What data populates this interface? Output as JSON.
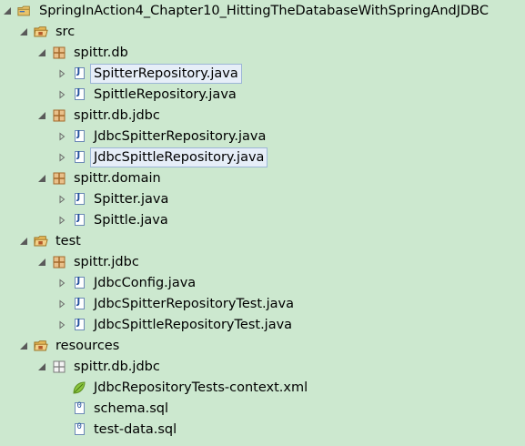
{
  "tree": {
    "project": "SpringInAction4_Chapter10_HittingTheDatabaseWithSpringAndJDBC",
    "src": "src",
    "pkg_db": "spittr.db",
    "spitter_repository": "SpitterRepository.java",
    "spittle_repository": "SpittleRepository.java",
    "pkg_db_jdbc": "spittr.db.jdbc",
    "jdbc_spitter_repository": "JdbcSpitterRepository.java",
    "jdbc_spittle_repository": "JdbcSpittleRepository.java",
    "pkg_domain": "spittr.domain",
    "spitter_java": "Spitter.java",
    "spittle_java": "Spittle.java",
    "test": "test",
    "pkg_jdbc": "spittr.jdbc",
    "jdbc_config": "JdbcConfig.java",
    "jdbc_spitter_repository_test": "JdbcSpitterRepositoryTest.java",
    "jdbc_spittle_repository_test": "JdbcSpittleRepositoryTest.java",
    "resources": "resources",
    "res_pkg_db_jdbc": "spittr.db.jdbc",
    "context_xml": "JdbcRepositoryTests-context.xml",
    "schema_sql": "schema.sql",
    "test_data_sql": "test-data.sql"
  },
  "icons": {
    "project": "project-folder-icon",
    "source_folder": "source-folder-icon",
    "package": "package-icon",
    "java_file": "java-file-icon",
    "xml_file": "spring-xml-file-icon",
    "sql_file": "sql-file-icon"
  },
  "colors": {
    "background": "#cce8cf",
    "selection_border": "#9cb6d6",
    "selection_fill": "#e6eef8",
    "package_icon": "#c08a4a",
    "folder_icon": "#d6a64a",
    "xml_leaf": "#8cc63e"
  }
}
